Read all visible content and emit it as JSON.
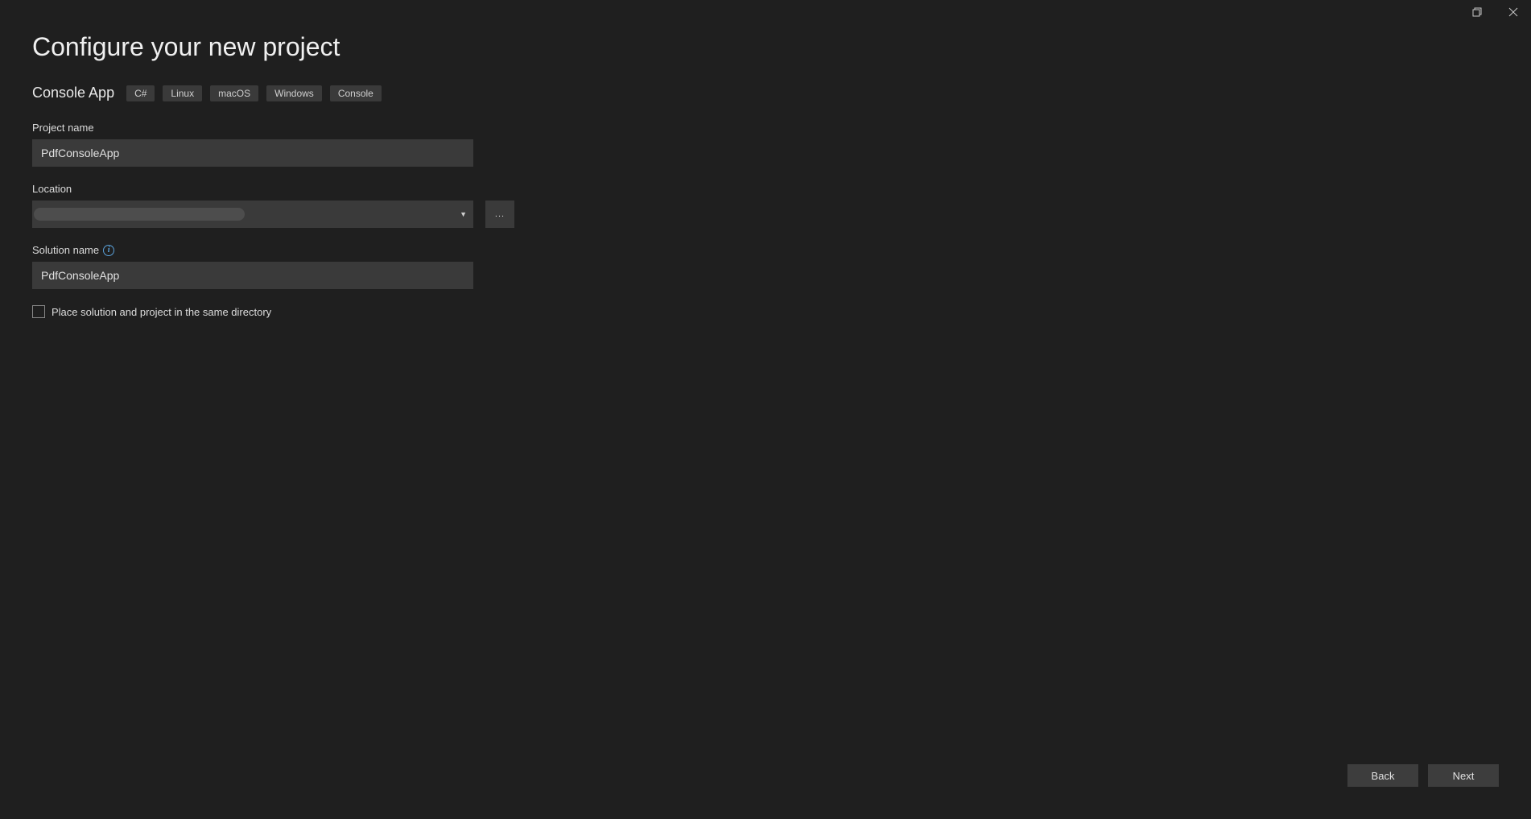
{
  "window": {
    "restore_tooltip": "Restore",
    "close_tooltip": "Close"
  },
  "header": {
    "title": "Configure your new project",
    "template_name": "Console App",
    "tags": [
      "C#",
      "Linux",
      "macOS",
      "Windows",
      "Console"
    ]
  },
  "form": {
    "project_name": {
      "label": "Project name",
      "value": "PdfConsoleApp"
    },
    "location": {
      "label": "Location",
      "value": "",
      "browse_label": "..."
    },
    "solution_name": {
      "label": "Solution name",
      "value": "PdfConsoleApp"
    },
    "same_dir_checkbox": {
      "label": "Place solution and project in the same directory",
      "checked": false
    }
  },
  "footer": {
    "back_label": "Back",
    "next_label": "Next"
  }
}
